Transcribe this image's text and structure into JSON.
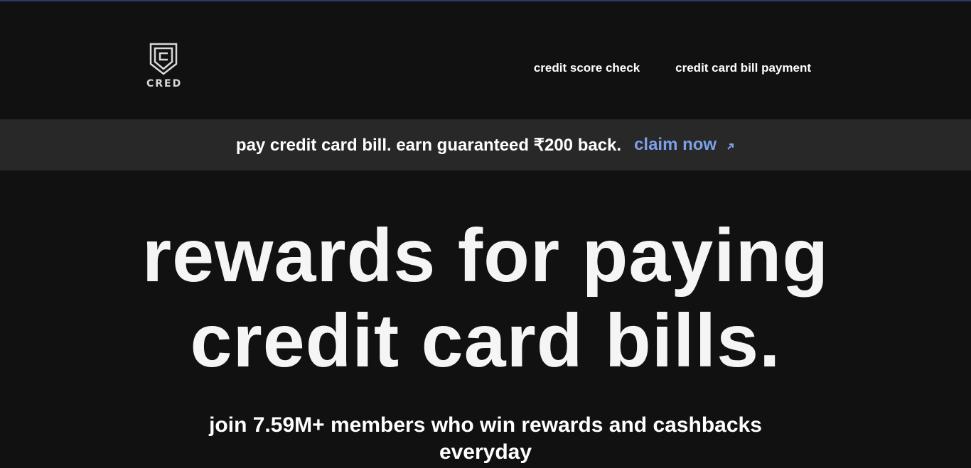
{
  "header": {
    "logo_text": "CRED",
    "logo_icon": "cred-shield-icon",
    "nav": [
      {
        "label": "credit score check"
      },
      {
        "label": "credit card bill payment"
      }
    ]
  },
  "promo": {
    "text": "pay credit card bill. earn guaranteed ₹200 back.",
    "cta_label": "claim now",
    "cta_icon": "arrow-up-right-icon",
    "cta_color": "#7c9fe6"
  },
  "hero": {
    "title_line1": "rewards for paying",
    "title_line2": "credit card bills.",
    "subtitle": "join 7.59M+ members who win rewards and cashbacks everyday"
  },
  "colors": {
    "background": "#111111",
    "promo_background": "#282828",
    "top_accent": "#2d3a66"
  }
}
